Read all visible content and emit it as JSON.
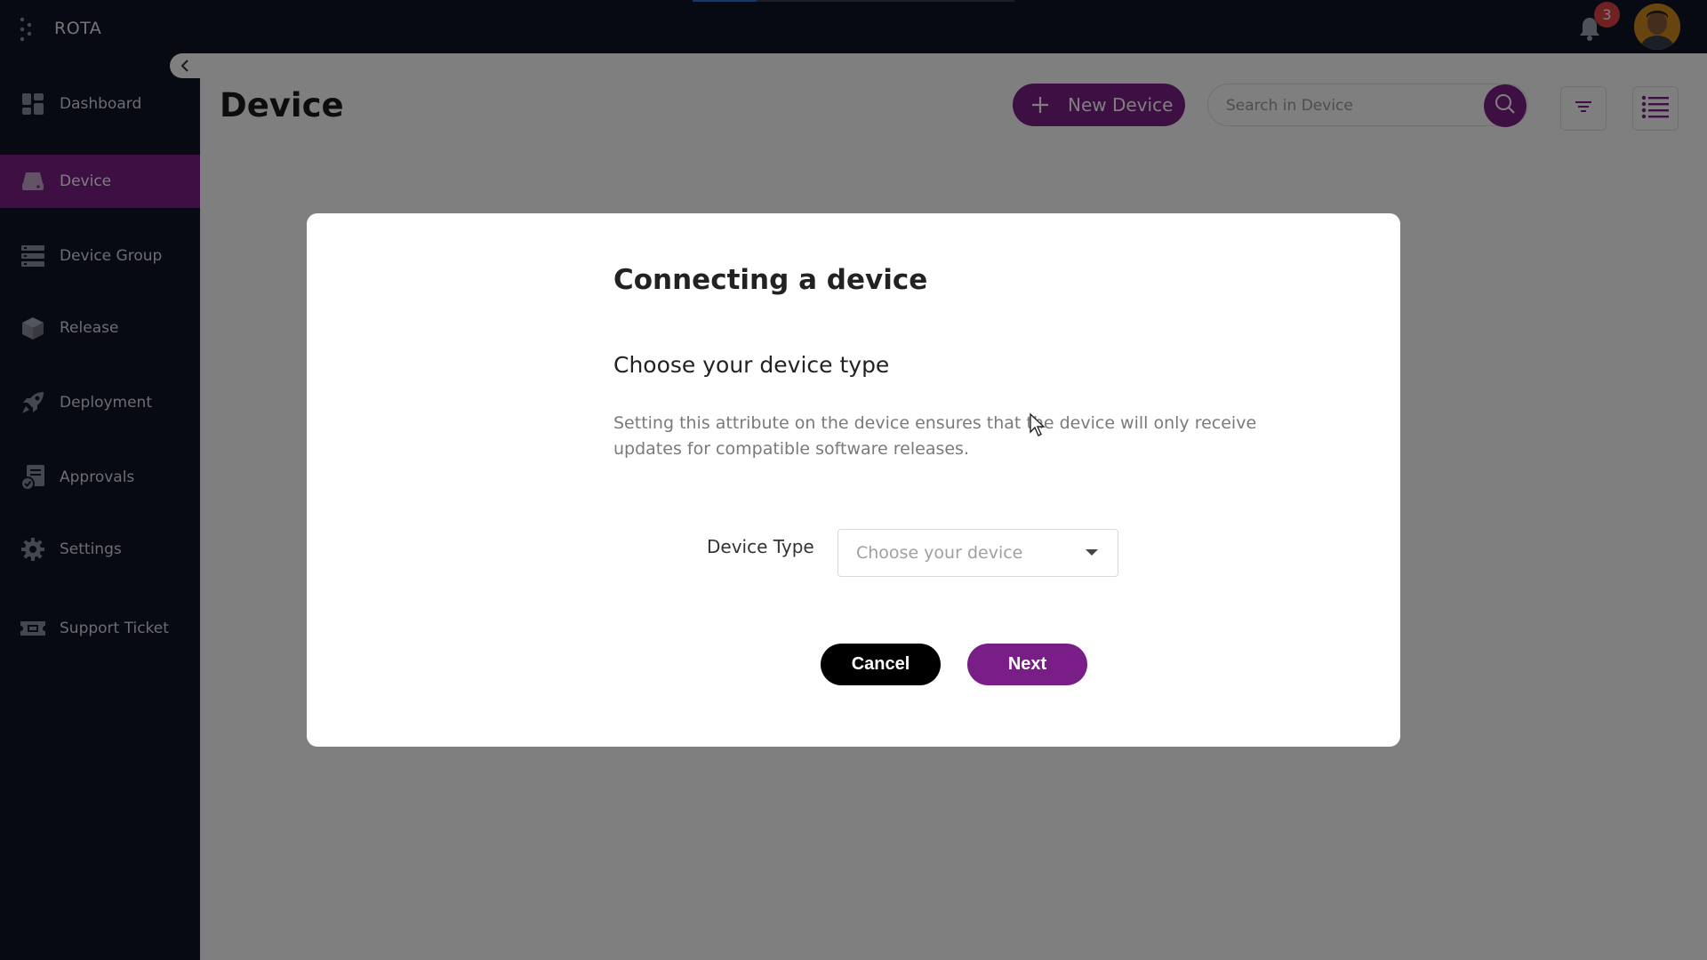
{
  "app": {
    "name": "ROTA"
  },
  "header": {
    "notification_count": "3"
  },
  "sidebar": {
    "items": [
      {
        "label": "Dashboard",
        "icon": "dashboard-icon",
        "active": false
      },
      {
        "label": "Device",
        "icon": "device-icon",
        "active": true
      },
      {
        "label": "Device Group",
        "icon": "device-group-icon",
        "active": false
      },
      {
        "label": "Release",
        "icon": "release-box-icon",
        "active": false
      },
      {
        "label": "Deployment",
        "icon": "rocket-icon",
        "active": false
      },
      {
        "label": "Approvals",
        "icon": "approvals-icon",
        "active": false
      },
      {
        "label": "Settings",
        "icon": "gear-icon",
        "active": false
      },
      {
        "label": "Support Ticket",
        "icon": "ticket-icon",
        "active": false
      }
    ]
  },
  "main": {
    "title": "Device",
    "new_button_label": "New Device",
    "search_placeholder": "Search in Device"
  },
  "modal": {
    "title": "Connecting a device",
    "subtitle": "Choose your device type",
    "description": "Setting this attribute on the device ensures that the device will only receive updates for compatible software releases.",
    "field_label": "Device Type",
    "select_placeholder": "Choose your device",
    "cancel_label": "Cancel",
    "next_label": "Next"
  },
  "colors": {
    "accent": "#7a1e87",
    "sidebar_bg": "#0f1525",
    "badge": "#e04343"
  }
}
